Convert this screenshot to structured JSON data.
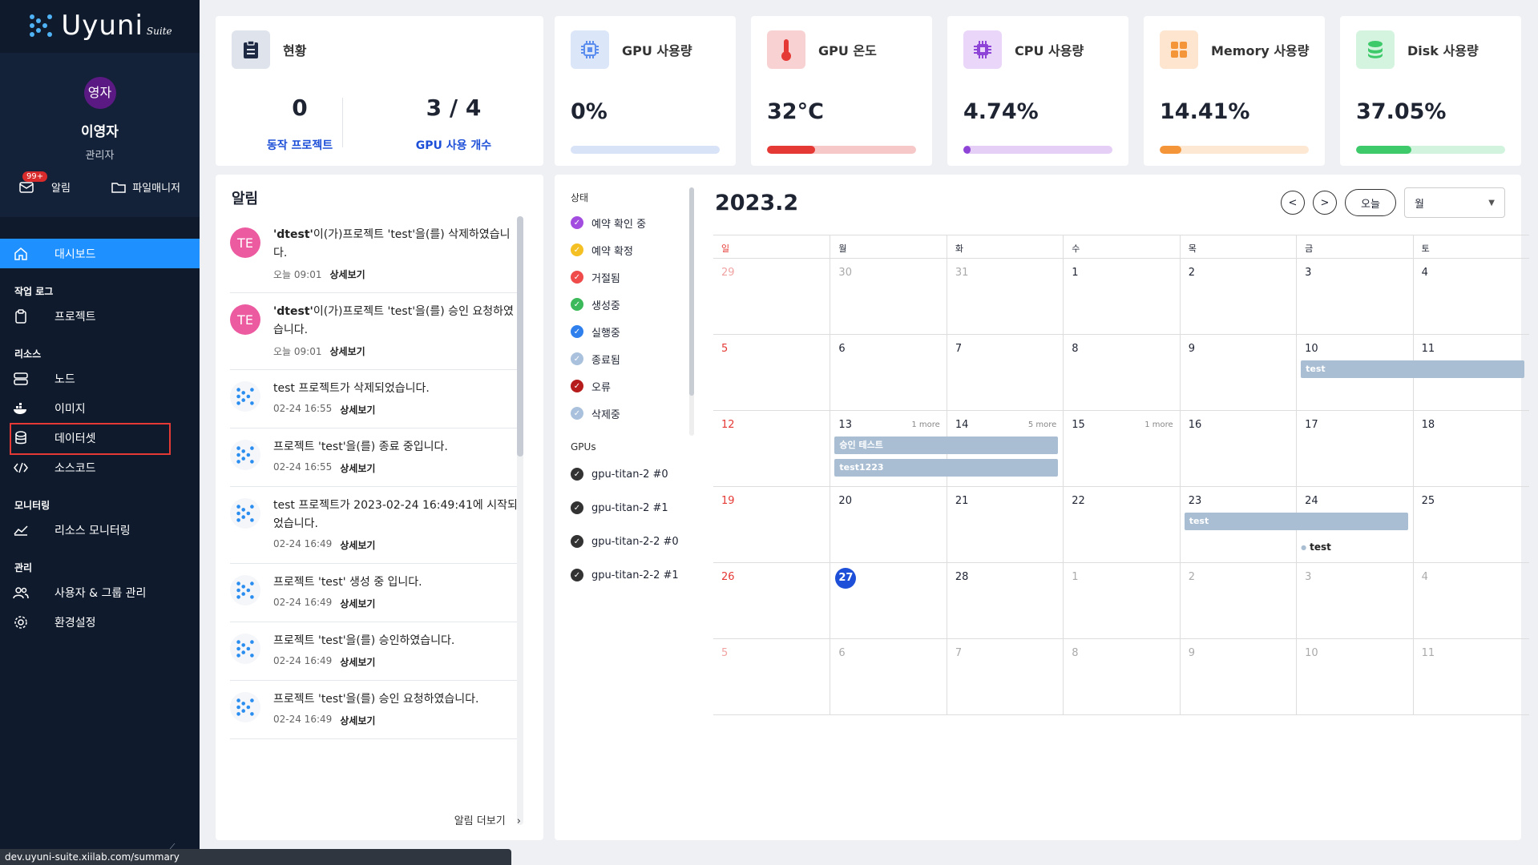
{
  "app": {
    "logo": "Uyuni",
    "logo_suffix": "Suite"
  },
  "profile": {
    "avatar": "영자",
    "name": "이영자",
    "role": "관리자",
    "alerts_label": "알림",
    "alerts_badge": "99+",
    "files_label": "파일매니저"
  },
  "nav": {
    "dashboard": "대시보드",
    "section_worklog": "작업 로그",
    "project": "프로젝트",
    "section_resource": "리소스",
    "node": "노드",
    "image": "이미지",
    "dataset": "데이터셋",
    "source": "소스코드",
    "section_monitor": "모니터링",
    "resource_monitor": "리소스 모니터링",
    "section_admin": "관리",
    "users_groups": "사용자 & 그룹 관리",
    "settings": "환경설정"
  },
  "overview": {
    "title": "현황",
    "running_value": "0",
    "running_label": "동작 프로젝트",
    "gpu_value": "3 / 4",
    "gpu_label": "GPU 사용 개수"
  },
  "metrics": [
    {
      "title": "GPU 사용량",
      "value": "0%",
      "percent": 0,
      "icon": "chip-icon",
      "color": "#5a8dee",
      "track": "#d8e3f7",
      "icon_bg": "#dbe6f9"
    },
    {
      "title": "GPU 온도",
      "value": "32°C",
      "percent": 32,
      "icon": "thermometer-icon",
      "color": "#e53935",
      "track": "#f6c8c8",
      "icon_bg": "#f8d2d2"
    },
    {
      "title": "CPU 사용량",
      "value": "4.74%",
      "percent": 4.74,
      "icon": "cpu-icon",
      "color": "#8e44d6",
      "track": "#e6cff7",
      "icon_bg": "#ead6f9"
    },
    {
      "title": "Memory 사용량",
      "value": "14.41%",
      "percent": 14.41,
      "icon": "memory-icon",
      "color": "#f5953a",
      "track": "#fde8d3",
      "icon_bg": "#fde5cf"
    },
    {
      "title": "Disk 사용량",
      "value": "37.05%",
      "percent": 37.05,
      "icon": "disk-icon",
      "color": "#3ec96b",
      "track": "#d2f3dd",
      "icon_bg": "#d5f4df"
    }
  ],
  "alerts": {
    "title": "알림",
    "more_label": "상세보기",
    "footer": "알림 더보기",
    "items": [
      {
        "avatar": "TE",
        "user": "'dtest'",
        "text": "이(가)프로젝트 'test'을(를) 삭제하였습니다.",
        "time": "오늘 09:01"
      },
      {
        "avatar": "TE",
        "user": "'dtest'",
        "text": "이(가)프로젝트 'test'을(를) 승인 요청하였습니다.",
        "time": "오늘 09:01"
      },
      {
        "avatar": "",
        "user": "",
        "text": "test 프로젝트가 삭제되었습니다.",
        "time": "02-24 16:55"
      },
      {
        "avatar": "",
        "user": "",
        "text": "프로젝트 'test'을(를) 종료 중입니다.",
        "time": "02-24 16:55"
      },
      {
        "avatar": "",
        "user": "",
        "text": "test 프로젝트가 2023-02-24 16:49:41에 시작되었습니다.",
        "time": "02-24 16:49"
      },
      {
        "avatar": "",
        "user": "",
        "text": "프로젝트 'test' 생성 중 입니다.",
        "time": "02-24 16:49"
      },
      {
        "avatar": "",
        "user": "",
        "text": "프로젝트 'test'을(를) 승인하였습니다.",
        "time": "02-24 16:49"
      },
      {
        "avatar": "",
        "user": "",
        "text": "프로젝트 'test'을(를) 승인 요청하였습니다.",
        "time": "02-24 16:49"
      }
    ]
  },
  "legend": {
    "status_header": "상태",
    "statuses": [
      {
        "label": "예약 확인 중",
        "color": "#a34de0"
      },
      {
        "label": "예약 확정",
        "color": "#f5c023"
      },
      {
        "label": "거절됨",
        "color": "#ef4b4b"
      },
      {
        "label": "생성중",
        "color": "#3cb95a"
      },
      {
        "label": "실행중",
        "color": "#2f80ed"
      },
      {
        "label": "종료됨",
        "color": "#a9c1dc"
      },
      {
        "label": "오류",
        "color": "#b71c1c"
      },
      {
        "label": "삭제중",
        "color": "#a9c1dc"
      }
    ],
    "gpus_header": "GPUs",
    "gpus": [
      "gpu-titan-2 #0",
      "gpu-titan-2 #1",
      "gpu-titan-2-2 #0",
      "gpu-titan-2-2 #1"
    ]
  },
  "calendar": {
    "title": "2023.2",
    "prev": "<",
    "next": ">",
    "today_label": "오늘",
    "view": "월",
    "weekdays": [
      "일",
      "월",
      "화",
      "수",
      "목",
      "금",
      "토"
    ],
    "weeks": [
      [
        {
          "d": "29",
          "m": true
        },
        {
          "d": "30",
          "m": true
        },
        {
          "d": "31",
          "m": true
        },
        {
          "d": "1"
        },
        {
          "d": "2"
        },
        {
          "d": "3"
        },
        {
          "d": "4"
        }
      ],
      [
        {
          "d": "5"
        },
        {
          "d": "6"
        },
        {
          "d": "7"
        },
        {
          "d": "8"
        },
        {
          "d": "9"
        },
        {
          "d": "10"
        },
        {
          "d": "11"
        }
      ],
      [
        {
          "d": "12"
        },
        {
          "d": "13",
          "more": "1 more"
        },
        {
          "d": "14",
          "more": "5 more"
        },
        {
          "d": "15",
          "more": "1 more"
        },
        {
          "d": "16"
        },
        {
          "d": "17"
        },
        {
          "d": "18"
        }
      ],
      [
        {
          "d": "19"
        },
        {
          "d": "20"
        },
        {
          "d": "21"
        },
        {
          "d": "22"
        },
        {
          "d": "23"
        },
        {
          "d": "24"
        },
        {
          "d": "25"
        }
      ],
      [
        {
          "d": "26"
        },
        {
          "d": "27",
          "today": true
        },
        {
          "d": "28"
        },
        {
          "d": "1",
          "m": true
        },
        {
          "d": "2",
          "m": true
        },
        {
          "d": "3",
          "m": true
        },
        {
          "d": "4",
          "m": true
        }
      ],
      [
        {
          "d": "5",
          "m": true
        },
        {
          "d": "6",
          "m": true
        },
        {
          "d": "7",
          "m": true
        },
        {
          "d": "8",
          "m": true
        },
        {
          "d": "9",
          "m": true
        },
        {
          "d": "10",
          "m": true
        },
        {
          "d": "11",
          "m": true
        }
      ]
    ],
    "events": [
      {
        "label": "test",
        "week": 1,
        "start": 5,
        "span": 2
      },
      {
        "label": "승인 테스트",
        "week": 2,
        "start": 1,
        "span": 2
      },
      {
        "label": "test1223",
        "week": 2,
        "start": 1,
        "span": 2
      },
      {
        "label": "test",
        "week": 3,
        "start": 4,
        "span": 2
      }
    ],
    "dot_event": {
      "label": "test",
      "week": 3,
      "col": 5
    }
  },
  "statusbar": {
    "url": "dev.uyuni-suite.xiilab.com/summary"
  }
}
